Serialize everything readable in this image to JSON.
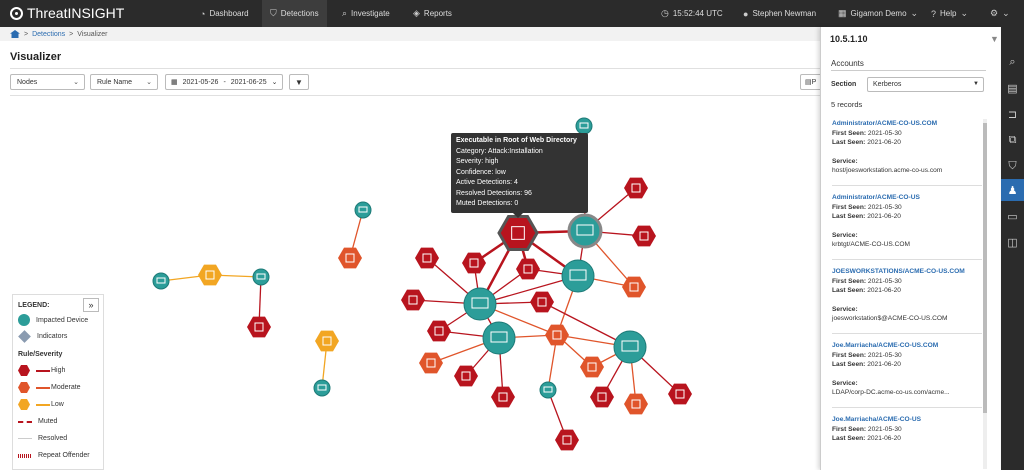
{
  "app": {
    "brand": "ThreatINSIGHT"
  },
  "nav": {
    "dashboard": "Dashboard",
    "detections": "Detections",
    "investigate": "Investigate",
    "reports": "Reports"
  },
  "topright": {
    "time": "15:52:44 UTC",
    "user": "Stephen Newman",
    "org": "Gigamon Demo",
    "help": "Help"
  },
  "breadcrumb": {
    "root": "Detections",
    "current": "Visualizer",
    "sep": ">"
  },
  "page": {
    "title": "Visualizer"
  },
  "filters": {
    "nodes": "Nodes",
    "rule": "Rule Name",
    "date_from": "2021-05-26",
    "date_sep": "-",
    "date_to": "2021-06-25",
    "export_partial": "P"
  },
  "tooltip": {
    "title": "Executable in Root of Web Directory",
    "category": "Category: Attack:Installation",
    "severity": "Severity: high",
    "confidence": "Confidence: low",
    "active": "Active Detections: 4",
    "resolved": "Resolved Detections: 96",
    "muted": "Muted Detections: 0"
  },
  "legend": {
    "title": "LEGEND:",
    "impacted": "Impacted Device",
    "indicators": "Indicators",
    "rule_title": "Rule/Severity",
    "high": "High",
    "moderate": "Moderate",
    "low": "Low",
    "muted": "Muted",
    "resolved": "Resolved",
    "repeat": "Repeat Offender",
    "colors": {
      "device": "#2c9d99",
      "indicator": "#8a9bb0",
      "high": "#b8141e",
      "moderate": "#e0552b",
      "low": "#f2a623"
    }
  },
  "panel": {
    "ip": "10.5.1.10",
    "accounts_label": "Accounts",
    "section_label": "Section",
    "section_value": "Kerberos",
    "records_count": "5 records",
    "first_label": "First Seen:",
    "last_label": "Last Seen:",
    "service_label": "Service:",
    "records": [
      {
        "user": "Administrator/ACME-CO-US.COM",
        "first": "2021-05-30",
        "last": "2021-06-20",
        "service": "host/joesworkstation.acme-co-us.com"
      },
      {
        "user": "Administrator/ACME-CO-US",
        "first": "2021-05-30",
        "last": "2021-06-20",
        "service": "krbtgt/ACME-CO-US.COM"
      },
      {
        "user": "JOESWORKSTATIONS/ACME-CO-US.COM",
        "first": "2021-05-30",
        "last": "2021-06-20",
        "service": "joesworkstation$@ACME-CO-US.COM"
      },
      {
        "user": "Joe.Marriacha/ACME-CO-US.COM",
        "first": "2021-05-30",
        "last": "2021-06-20",
        "service": "LDAP/corp-DC.acme-co-us.com/acme..."
      },
      {
        "user": "Joe.Marriacha/ACME-CO-US",
        "first": "2021-05-30",
        "last": "2021-06-20",
        "service": ""
      }
    ]
  }
}
